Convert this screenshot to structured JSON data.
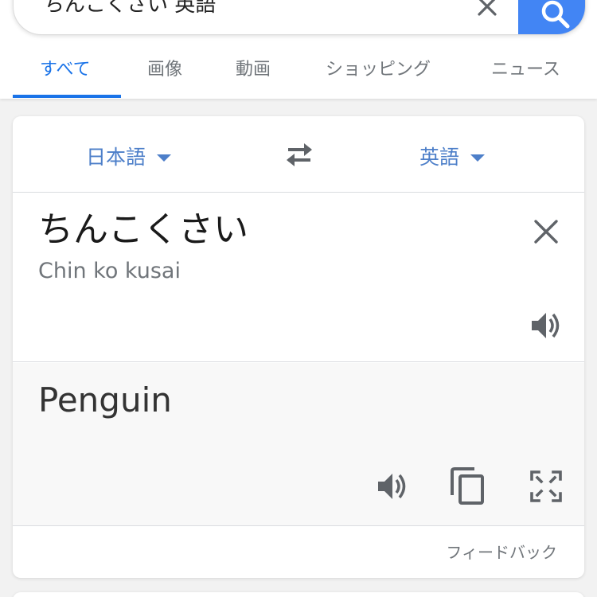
{
  "search": {
    "query": "ちんこくさい 英語",
    "clear_icon": "close-icon",
    "search_icon": "search-icon",
    "accent": "#4285f4"
  },
  "tabs": [
    {
      "label": "すべて",
      "active": true
    },
    {
      "label": "画像",
      "active": false
    },
    {
      "label": "動画",
      "active": false
    },
    {
      "label": "ショッピング",
      "active": false
    },
    {
      "label": "ニュース",
      "active": false
    }
  ],
  "translator": {
    "source_language": "日本語",
    "target_language": "英語",
    "swap_icon": "swap-arrows-icon",
    "source_text": "ちんこくさい",
    "source_romanization": "Chin ko kusai",
    "target_text": "Penguin",
    "feedback_label": "フィードバック",
    "icons": [
      "close-icon",
      "speaker-icon",
      "copy-icon",
      "fullscreen-icon"
    ],
    "link_color": "#4d7fc9"
  }
}
